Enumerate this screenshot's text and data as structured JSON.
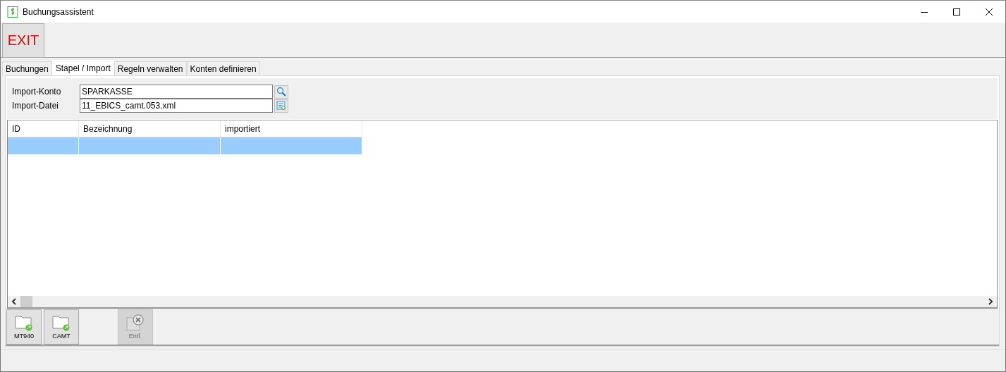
{
  "window": {
    "title": "Buchungsassistent"
  },
  "toolbar": {
    "exit_label": "EXIT"
  },
  "tabs": [
    {
      "label": "Buchungen",
      "selected": false
    },
    {
      "label": "Stapel / Import",
      "selected": true
    },
    {
      "label": "Regeln verwalten",
      "selected": false
    },
    {
      "label": "Konten definieren",
      "selected": false
    }
  ],
  "fields": [
    {
      "label": "Import-Konto",
      "value": "SPARKASSE",
      "kind": "search"
    },
    {
      "label": "Import-Datei",
      "value": "11_EBICS_camt.053.xml",
      "kind": "file"
    }
  ],
  "table": {
    "columns": [
      "ID",
      "Bezeichnung",
      "importiert"
    ],
    "rows": [
      {
        "cells": [
          "",
          "",
          ""
        ],
        "selected": true
      }
    ]
  },
  "buttons": [
    {
      "label": "MT940",
      "kind": "import",
      "disabled": false
    },
    {
      "label": "CAMT",
      "kind": "import",
      "disabled": false
    },
    {
      "label": "Entf.",
      "kind": "delete",
      "disabled": true
    }
  ]
}
